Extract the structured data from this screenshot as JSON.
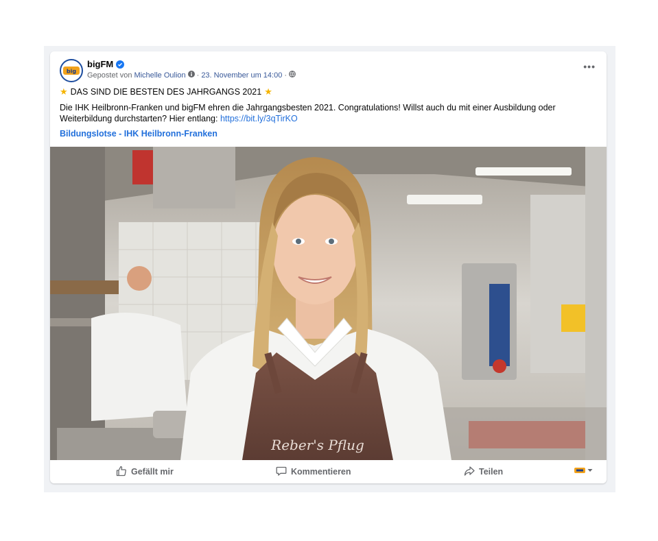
{
  "post": {
    "page_name": "bigFM",
    "posted_by_prefix": "Gepostet von",
    "posted_by_name": "Michelle Oulion",
    "separator": "·",
    "date": "23. November um 14:00",
    "headline": "DAS SIND DIE BESTEN DES JAHRGANGS 2021",
    "body": "Die IHK Heilbronn-Franken und bigFM ehren die Jahrgangsbesten 2021. Congratulations! Willst auch du mit einer Ausbildung oder Weiterbildung durchstarten? Hier entlang: ",
    "link": "https://bit.ly/3qTirKO",
    "tag": "Bildungslotse - IHK Heilbronn-Franken",
    "apron_text": "Reber's Pflug"
  },
  "actions": {
    "like": "Gefällt mir",
    "comment": "Kommentieren",
    "share": "Teilen"
  },
  "icons": {
    "avatar": "bigfm-logo",
    "verified": "verified-badge-icon",
    "info": "info-icon",
    "audience": "globe-icon",
    "more": "more-options-icon",
    "headline": "star-icon",
    "like": "thumbs-up-icon",
    "comment": "comment-bubble-icon",
    "share": "share-arrow-icon"
  },
  "colors": {
    "link": "#216fdb",
    "verified": "#1877f2",
    "muted": "#65676b",
    "star": "#f5b400",
    "feed_bg": "#f0f2f5"
  }
}
